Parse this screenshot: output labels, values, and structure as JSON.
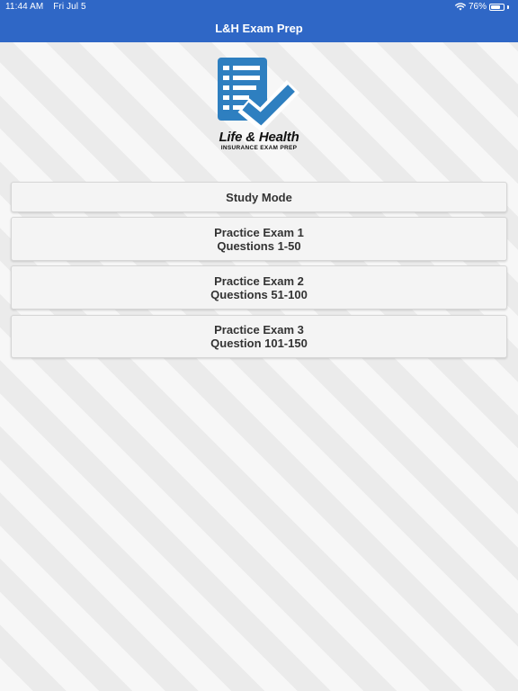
{
  "status_bar": {
    "time": "11:44 AM",
    "date": "Fri Jul 5",
    "battery_text": "76%",
    "battery_level": 0.76,
    "wifi_icon": "wifi-icon"
  },
  "nav": {
    "title": "L&H Exam Prep"
  },
  "logo": {
    "title": "Life & Health",
    "subtitle": "INSURANCE EXAM PREP",
    "icon": "checklist-check-icon",
    "color": "#2e7fc0"
  },
  "menu": {
    "study_mode": {
      "line1": "Study Mode"
    },
    "exam1": {
      "line1": "Practice Exam 1",
      "line2": "Questions 1-50"
    },
    "exam2": {
      "line1": "Practice Exam 2",
      "line2": "Questions 51-100"
    },
    "exam3": {
      "line1": "Practice Exam 3",
      "line2": "Question 101-150"
    }
  },
  "colors": {
    "nav_bar": "#2f67c6",
    "button_bg": "#f4f4f4",
    "button_text": "#333333"
  }
}
